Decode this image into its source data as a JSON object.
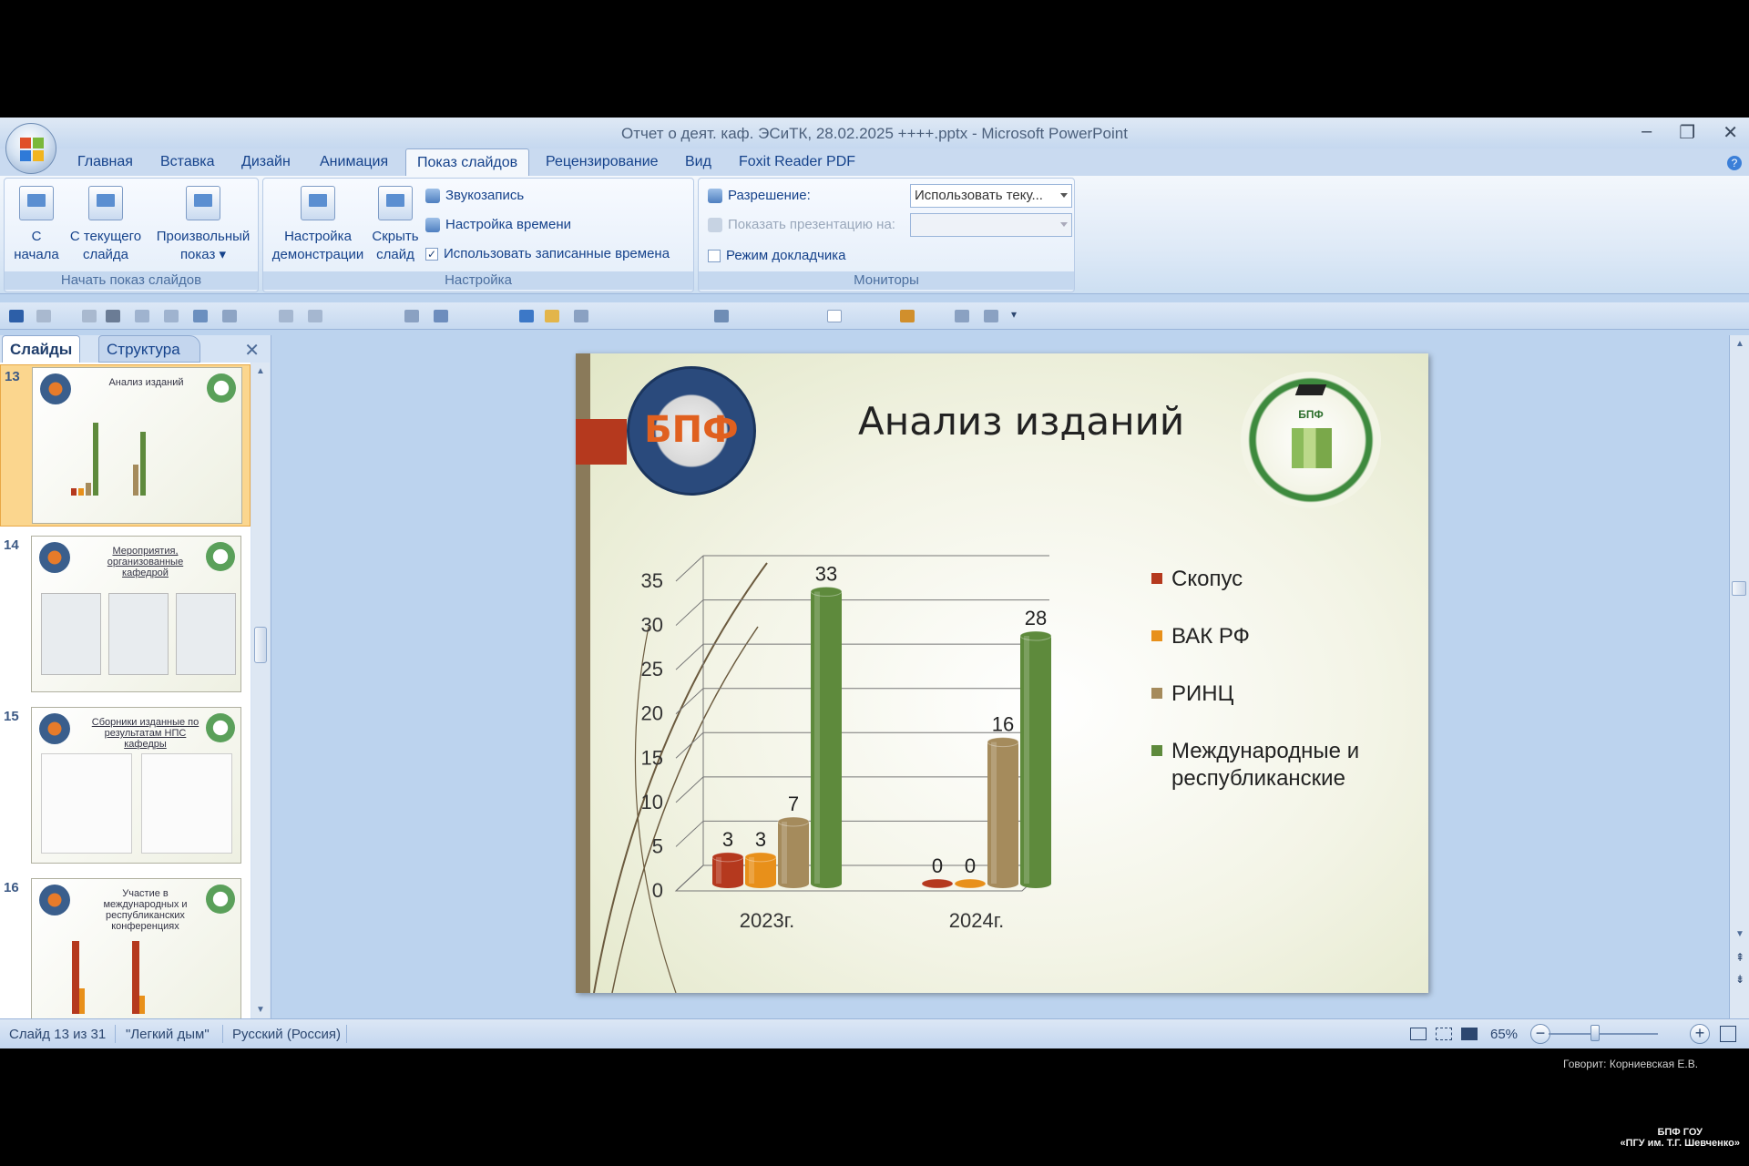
{
  "window": {
    "title": "Отчет о деят. каф. ЭСиТК, 28.02.2025 ++++.pptx - Microsoft PowerPoint"
  },
  "tabs": [
    "Главная",
    "Вставка",
    "Дизайн",
    "Анимация",
    "Показ слайдов",
    "Рецензирование",
    "Вид",
    "Foxit Reader PDF"
  ],
  "active_tab": "Показ слайдов",
  "ribbon": {
    "start_group": {
      "label": "Начать показ слайдов",
      "from_start": "С\nначала",
      "from_current": "С текущего\nслайда",
      "custom": "Произвольный\nпоказ ▾"
    },
    "setup_group": {
      "label": "Настройка",
      "setup_show": "Настройка\nдемонстрации",
      "hide_slide": "Скрыть\nслайд",
      "record_narration": "Звукозапись",
      "rehearse_timings": "Настройка времени",
      "use_timings": "Использовать записанные времена",
      "use_timings_checked": true
    },
    "monitors_group": {
      "label": "Мониторы",
      "resolution_label": "Разрешение:",
      "resolution_value": "Использовать теку...",
      "show_on_label": "Показать презентацию на:",
      "presenter_view": "Режим докладчика"
    }
  },
  "panel": {
    "tab_slides": "Слайды",
    "tab_outline": "Структура",
    "thumbnails": [
      {
        "num": "13",
        "title": "Анализ изданий",
        "selected": true
      },
      {
        "num": "14",
        "title": "Мероприятия, организованные кафедрой",
        "selected": false
      },
      {
        "num": "15",
        "title": "Сборники изданные по результатам НПС кафедры",
        "selected": false
      },
      {
        "num": "16",
        "title": "Участие в международных и республиканских конференциях",
        "selected": false
      }
    ]
  },
  "slide": {
    "title": "Анализ изданий",
    "logo_left_text": "БПФ",
    "logo_right_text": "БПФ"
  },
  "chart_data": {
    "type": "bar",
    "categories": [
      "2023г.",
      "2024г."
    ],
    "series": [
      {
        "name": "Скопус",
        "values": [
          3,
          0
        ],
        "color": "#b5391e"
      },
      {
        "name": "ВАК РФ",
        "values": [
          3,
          0
        ],
        "color": "#e8901a"
      },
      {
        "name": "РИНЦ",
        "values": [
          7,
          16
        ],
        "color": "#a58b5c"
      },
      {
        "name": "Международные и республиканские",
        "values": [
          33,
          28
        ],
        "color": "#5e8a3c"
      }
    ],
    "ylim": [
      0,
      35
    ],
    "yticks": [
      "0",
      "5",
      "10",
      "15",
      "20",
      "25",
      "30",
      "35"
    ],
    "legend": [
      "Скопус",
      "ВАК РФ",
      "РИНЦ",
      "Международные и",
      "республиканские"
    ],
    "grid": true,
    "legend_position": "right"
  },
  "status": {
    "slide_info": "Слайд 13 из 31",
    "theme": "\"Легкий дым\"",
    "language": "Русский (Россия)",
    "zoom": "65%"
  },
  "overlay": {
    "speaker": "Говорит: Корниевская Е.В.",
    "watermark_line1": "БПФ ГОУ",
    "watermark_line2": "«ПГУ им. Т.Г. Шевченко»"
  }
}
